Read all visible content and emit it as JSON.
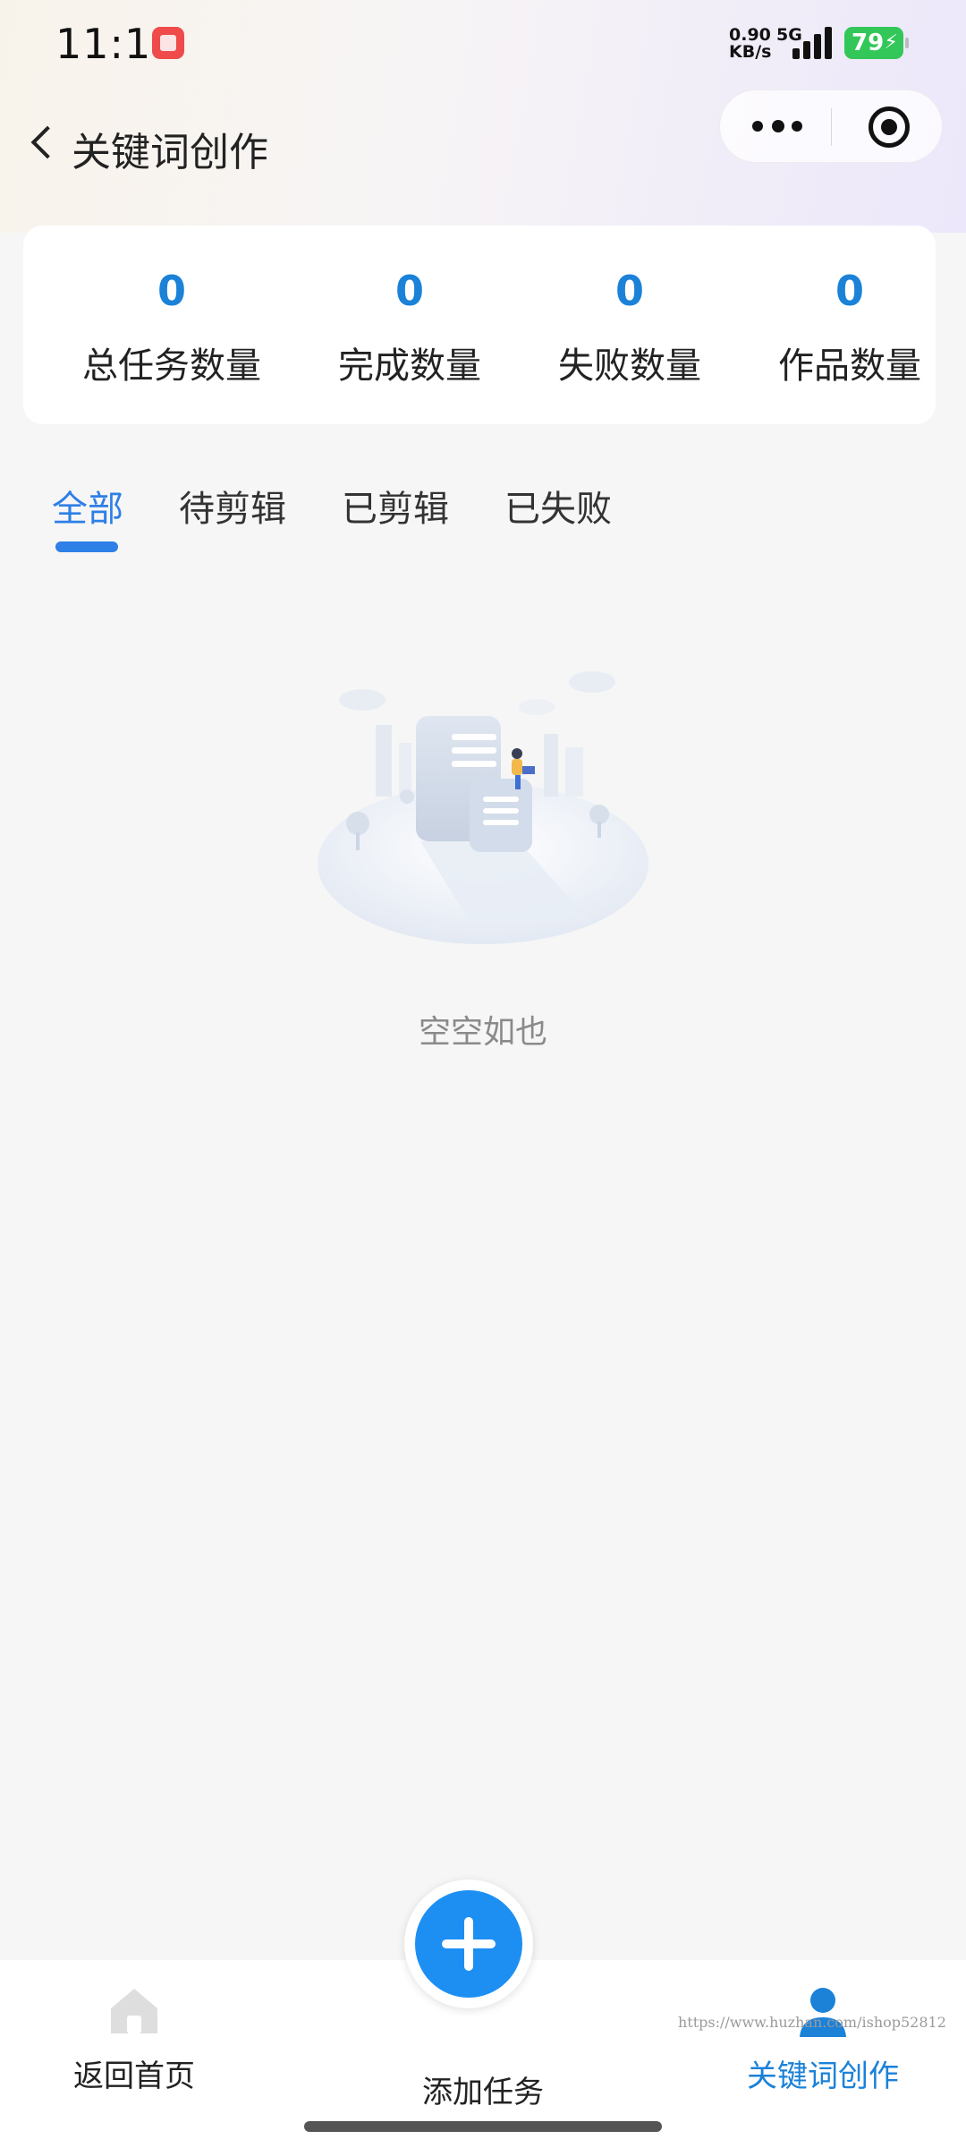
{
  "status_bar": {
    "time": "11:13",
    "net_speed_value": "0.90",
    "net_speed_unit": "KB/s",
    "network": "5G",
    "battery": "79"
  },
  "nav": {
    "title": "关键词创作"
  },
  "stats": [
    {
      "value": "0",
      "label": "总任务数量"
    },
    {
      "value": "0",
      "label": "完成数量"
    },
    {
      "value": "0",
      "label": "失败数量"
    },
    {
      "value": "0",
      "label": "作品数量"
    }
  ],
  "tabs": [
    "全部",
    "待剪辑",
    "已剪辑",
    "已失败"
  ],
  "empty_state": {
    "text": "空空如也"
  },
  "tabbar": {
    "home_label": "返回首页",
    "add_label": "添加任务",
    "keyword_label": "关键词创作"
  },
  "watermark": "https://www.huzhan.com/ishop52812",
  "colors": {
    "accent": "#2e7fe6",
    "stat_value": "#1b82d8",
    "fab": "#1d8ff3"
  }
}
